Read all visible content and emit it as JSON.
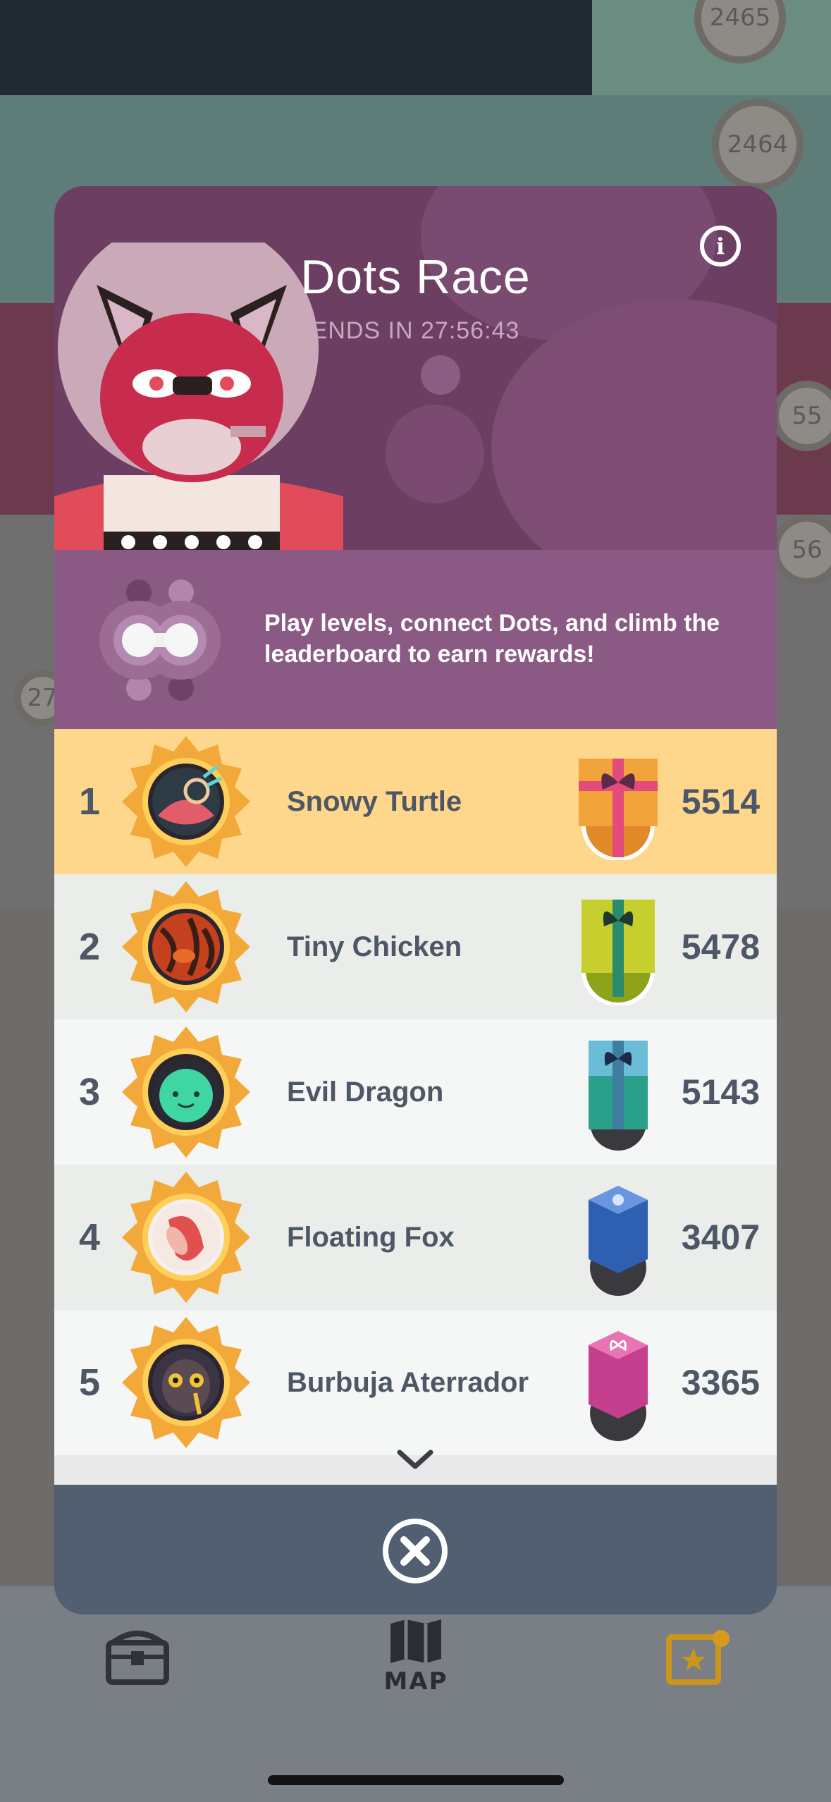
{
  "background": {
    "map_nodes": [
      "2465",
      "2464",
      "55",
      "56",
      "27"
    ]
  },
  "tabbar": {
    "map_label": "MAP"
  },
  "modal": {
    "title": "Dots Race",
    "ends_label": "ENDS IN 27:56:43",
    "info_glyph": "i",
    "description": "Play levels, connect Dots, and climb the leaderboard to earn rewards!",
    "colors": {
      "hero": "#6b3e62",
      "description_band": "#8a5a84",
      "first_place_row": "#ffd78c",
      "alt_row": "#eaede9",
      "plain_row": "#f5f6f6",
      "footer": "#515f70"
    }
  },
  "leaderboard": {
    "rows": [
      {
        "rank": "1",
        "name": "Snowy Turtle",
        "score": "5514",
        "reward_icon": "orange-gift-box-icon"
      },
      {
        "rank": "2",
        "name": "Tiny Chicken",
        "score": "5478",
        "reward_icon": "yellow-gift-box-icon"
      },
      {
        "rank": "3",
        "name": "Evil Dragon",
        "score": "5143",
        "reward_icon": "teal-gift-box-icon"
      },
      {
        "rank": "4",
        "name": "Floating Fox",
        "score": "3407",
        "reward_icon": "blue-hexagon-box-icon"
      },
      {
        "rank": "5",
        "name": "Burbuja Aterrador",
        "score": "3365",
        "reward_icon": "pink-hexagon-box-icon"
      }
    ]
  }
}
